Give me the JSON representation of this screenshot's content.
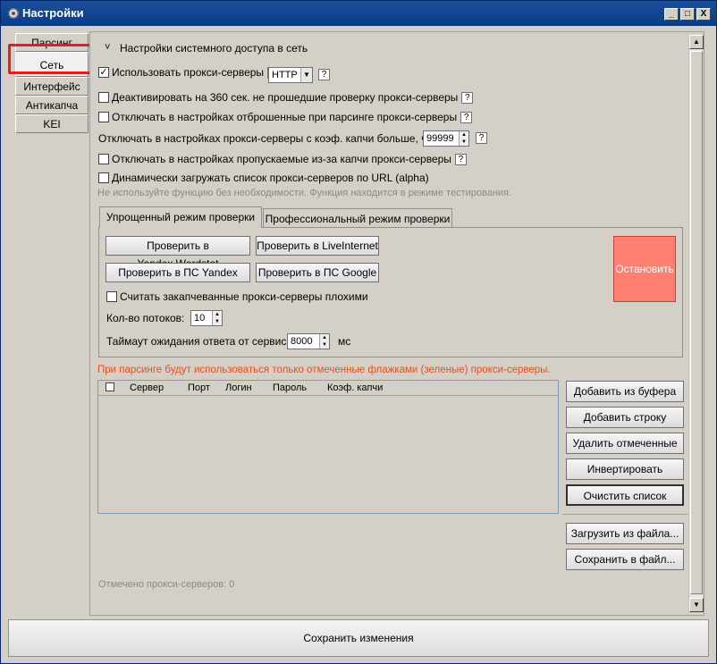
{
  "window": {
    "title": "Настройки",
    "btn_min": "_",
    "btn_max": "□",
    "btn_close": "X"
  },
  "sidebar": {
    "items": [
      {
        "label": "Парсинг"
      },
      {
        "label": "Сеть"
      },
      {
        "label": "Интерфейс"
      },
      {
        "label": "Антикапча"
      },
      {
        "label": "KEI"
      }
    ]
  },
  "section": {
    "collapse_icon": "˅",
    "title": "Настройки системного доступа в сеть"
  },
  "options": {
    "use_proxy": "Использовать прокси-серверы",
    "proxy_type": "HTTP",
    "deactivate_360": "Деактивировать на 360 сек. не прошедшие проверку прокси-серверы",
    "disable_dropped": "Отключать в настройках отброшенные при парсинге прокси-серверы",
    "captcha_coef_label": "Отключать в настройках прокси-серверы с коэф. капчи больше, чем:",
    "captcha_coef_value": "99999",
    "disable_captcha_skipped": "Отключать в настройках пропускаемые из-за капчи прокси-серверы",
    "dynamic_load": "Динамически загружать список прокси-серверов по URL (alpha)",
    "dynamic_note": "Не используйте функцию без необходимости. Функция находится в режиме тестирования.",
    "help": "?"
  },
  "tabs": [
    {
      "label": "Упрощенный режим проверки"
    },
    {
      "label": "Профессиональный режим проверки"
    }
  ],
  "check": {
    "btn_wordstat": "Проверить в Yandex.Wordstat",
    "btn_liveinternet": "Проверить в LiveInternet",
    "btn_ps_yandex": "Проверить в ПС Yandex",
    "btn_ps_google": "Проверить в ПС Google",
    "btn_stop": "Остановить",
    "captcha_bad": "Считать закапчеванные прокси-серверы плохими",
    "threads_label": "Кол-во потоков:",
    "threads_value": "10",
    "timeout_label": "Таймаут ожидания ответа от сервиса:",
    "timeout_value": "8000",
    "timeout_unit": "мс"
  },
  "notice": "При парсинге будут использоваться только отмеченные флажками (зеленые) прокси-серверы.",
  "table": {
    "columns": [
      "Сервер",
      "Порт",
      "Логин",
      "Пароль",
      "Коэф. капчи"
    ]
  },
  "actions": {
    "add_clipboard": "Добавить из буфера",
    "add_row": "Добавить строку",
    "delete_marked": "Удалить отмеченные",
    "invert_mark": "Инвертировать отметку",
    "clear_list": "Очистить список",
    "load_file": "Загрузить из файла...",
    "save_file": "Сохранить в файл..."
  },
  "status": "Отмечено прокси-серверов: 0",
  "save_changes": "Сохранить изменения",
  "colors": {
    "titlebar": "#0b3b86",
    "stop": "#ff8070",
    "notice": "#e8501a",
    "highlight": "#e02020"
  }
}
